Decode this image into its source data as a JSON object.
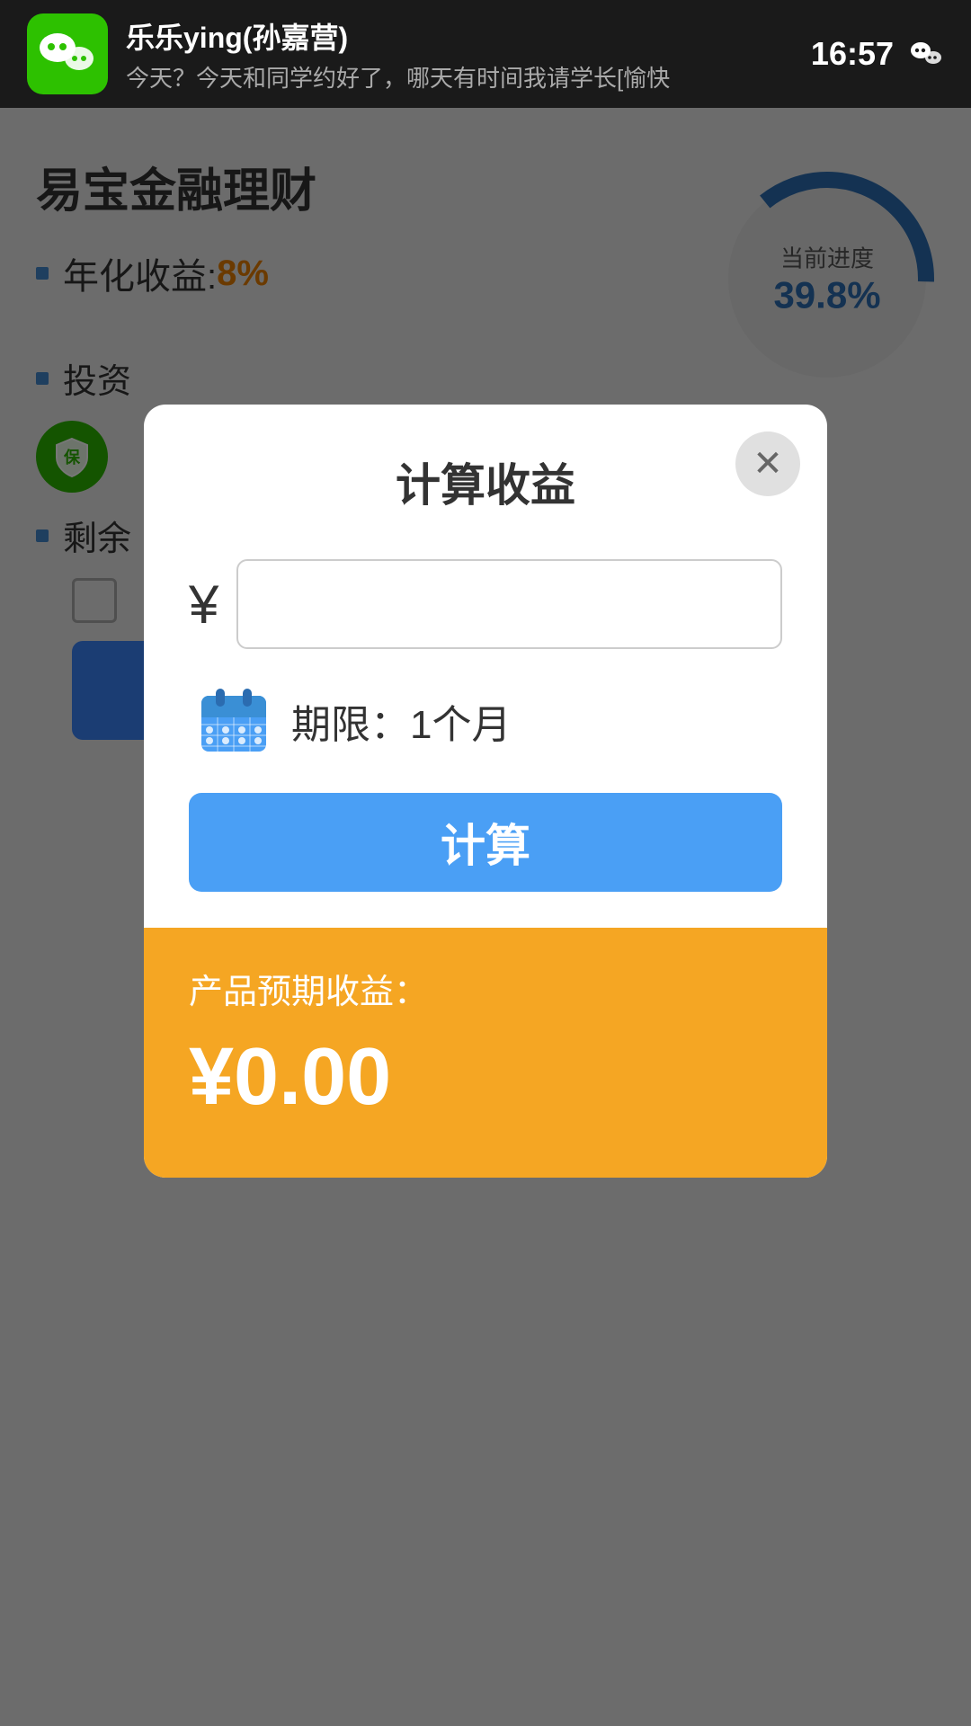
{
  "statusBar": {
    "appName": "乐乐ying(孙嘉营)",
    "notifText": "今天？今天和同学约好了，哪天有时间我请学长[愉快",
    "time": "16:57"
  },
  "background": {
    "title": "易宝金融理财",
    "yieldLabel": "年化收益:",
    "yieldValue": "8%",
    "progressLabel": "当前进度",
    "progressValue": "39.8%",
    "investLabel": "投资",
    "remainLabel": "剩余"
  },
  "modal": {
    "title": "计算收益",
    "closeIcon": "✕",
    "yuanSign": "¥",
    "inputPlaceholder": "",
    "periodIcon": "calendar",
    "periodText": "期限：1个月",
    "calcBtnLabel": "计算",
    "resultLabel": "产品预期收益：",
    "resultValue": "¥0.00"
  }
}
